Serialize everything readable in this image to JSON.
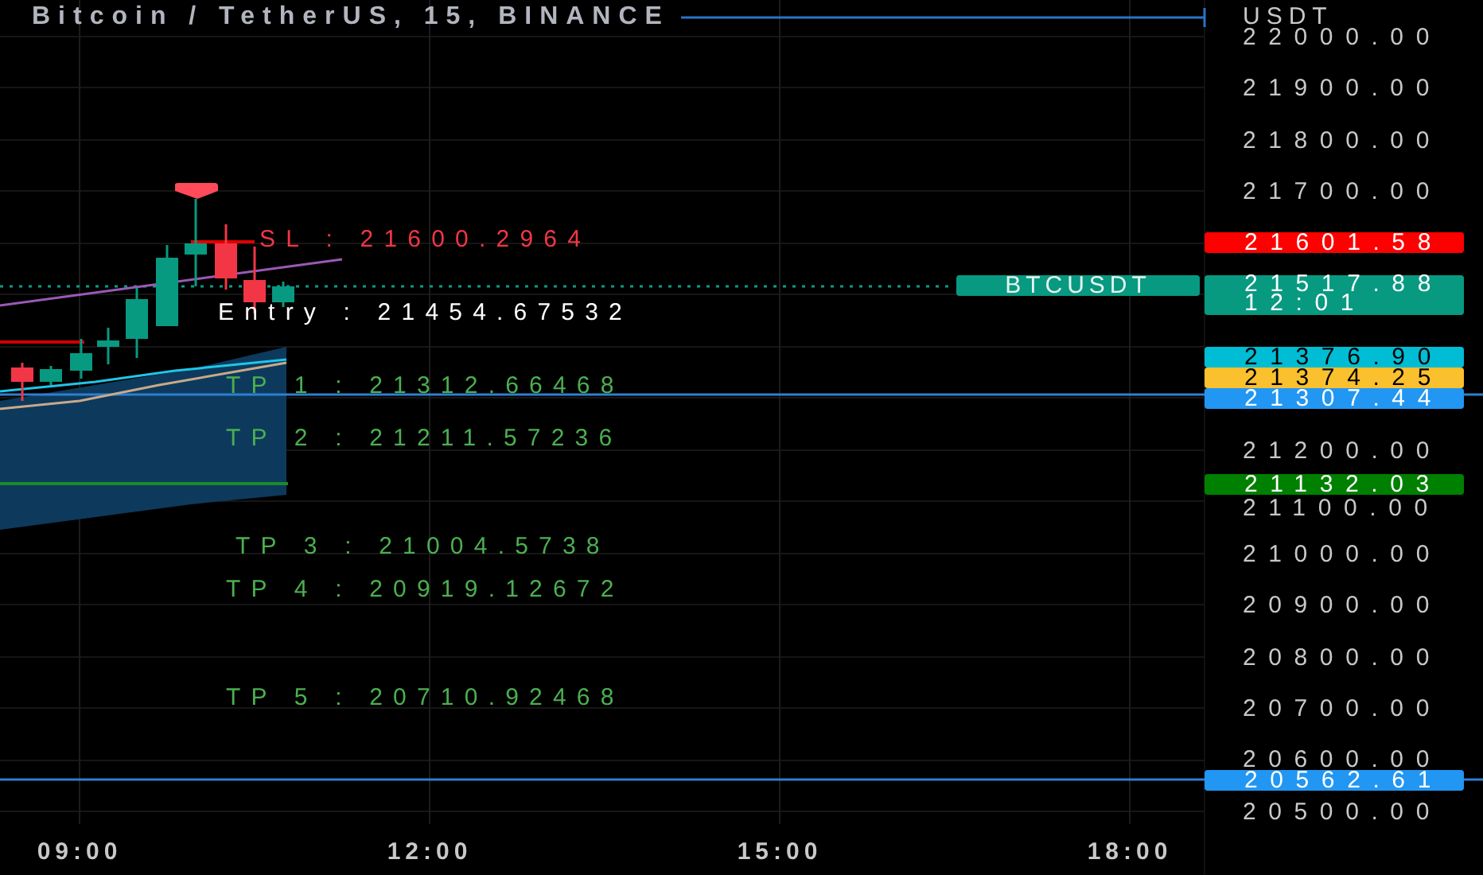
{
  "chart": {
    "title": "Bitcoin / TetherUS, 15, BINANCE",
    "currency": "USDT",
    "price_axis": [
      "22000.00",
      "21900.00",
      "21800.00",
      "21700.00",
      "21200.00",
      "21100.00",
      "21000.00",
      "20900.00",
      "20800.00",
      "20700.00",
      "20600.00",
      "20500.00"
    ],
    "time_axis": [
      "09:00",
      "12:00",
      "15:00",
      "18:00"
    ],
    "annotations": [
      {
        "kind": "sl",
        "text": "SL : 21600.2964"
      },
      {
        "kind": "entry",
        "text": "Entry : 21454.67532"
      },
      {
        "kind": "tp",
        "text": "TP 1 : 21312.66468"
      },
      {
        "kind": "tp",
        "text": "TP 2 : 21211.57236"
      },
      {
        "kind": "tp",
        "text": "TP 3 : 21004.5738"
      },
      {
        "kind": "tp",
        "text": "TP 4 : 20919.12672"
      },
      {
        "kind": "tp",
        "text": "TP 5 : 20710.92468"
      }
    ],
    "last_price": {
      "symbol": "BTCUSDT",
      "price": "21517.88",
      "countdown": "12:01",
      "color": "#089981"
    },
    "price_tags": [
      {
        "text": "21601.58",
        "color": "#ff0000"
      },
      {
        "text": "21376.90",
        "color": "#00bcd4"
      },
      {
        "text": "21374.25",
        "color": "#fbc02d"
      },
      {
        "text": "21307.44",
        "color": "#2196f3"
      },
      {
        "text": "21132.03",
        "color": "#008000"
      },
      {
        "text": "20562.61",
        "color": "#2196f3"
      }
    ]
  }
}
